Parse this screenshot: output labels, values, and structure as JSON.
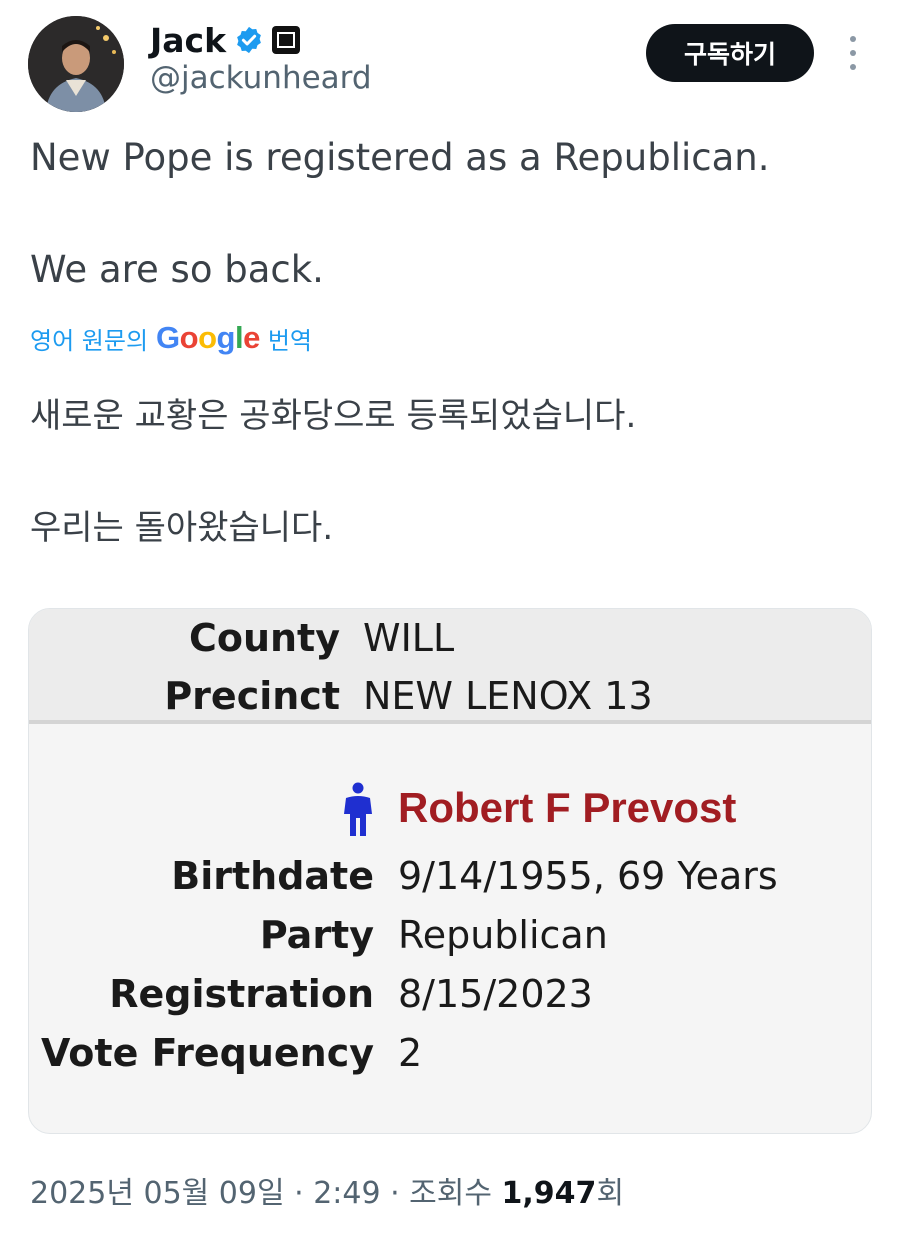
{
  "author": {
    "display_name": "Jack",
    "handle": "@jackunheard",
    "avatar_icon": "profile-photo",
    "verified_icon": "verified-badge-icon"
  },
  "actions": {
    "subscribe_label": "구독하기",
    "more_icon": "more-options-icon"
  },
  "tweet": {
    "line1": "New Pope is registered as a Republican.",
    "line2": "We are so back."
  },
  "translation": {
    "prefix": "영어 원문의",
    "google_brand": "Google",
    "suffix": "번역",
    "line1": "새로운 교황은 공화당으로 등록되었습니다.",
    "line2": "우리는 돌아왔습니다."
  },
  "record": {
    "county_label": "County",
    "county_value": "WILL",
    "precinct_label": "Precinct",
    "precinct_value": "NEW LENOX 13",
    "name": "Robert F Prevost",
    "birthdate_label": "Birthdate",
    "birthdate_value": "9/14/1955, 69 Years",
    "party_label": "Party",
    "party_value": "Republican",
    "registration_label": "Registration",
    "registration_value": "8/15/2023",
    "vote_frequency_label": "Vote Frequency",
    "vote_frequency_value": "2"
  },
  "meta": {
    "date": "2025년 05월 09일",
    "time": "2:49",
    "views_label": "조회수",
    "views_count": "1,947",
    "views_suffix": "회"
  },
  "colors": {
    "brand_blue": "#1d9bf0",
    "record_name_red": "#a11d22",
    "person_icon_blue": "#1f2fd0"
  }
}
